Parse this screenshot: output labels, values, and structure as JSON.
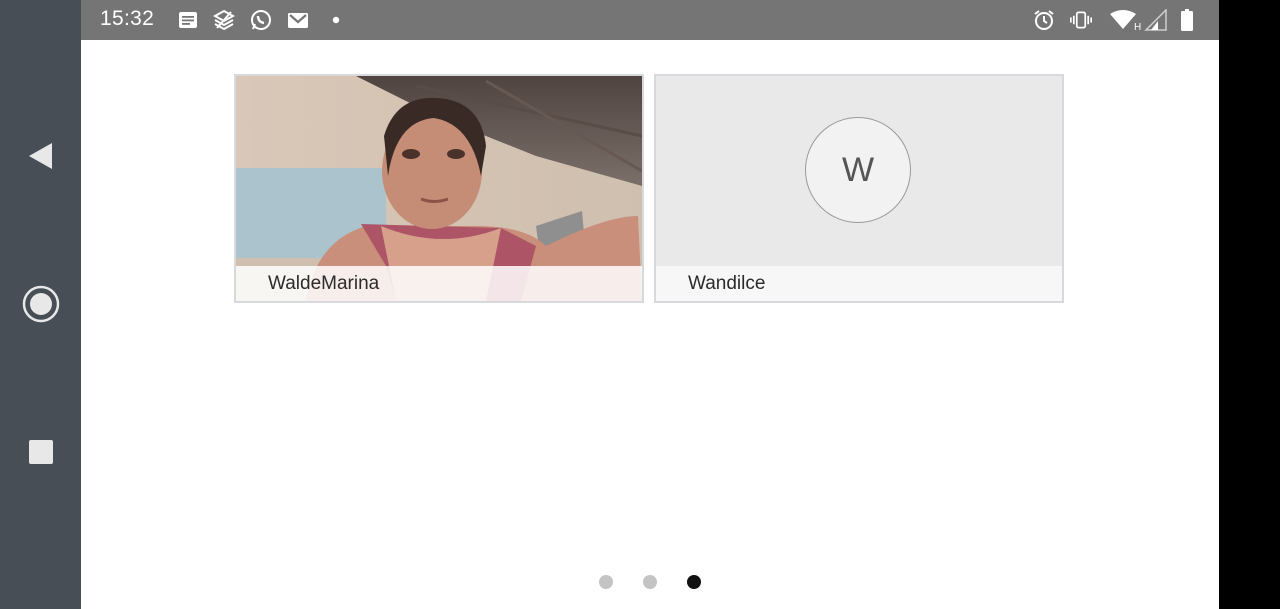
{
  "status_bar": {
    "time": "15:32",
    "left_icons": [
      "notes-icon",
      "stacks-icon",
      "whatsapp-icon",
      "gmail-icon",
      "dot-icon"
    ],
    "right_icons": [
      "alarm-icon",
      "vibrate-icon",
      "wifi-icon",
      "signal-icon",
      "battery-icon"
    ],
    "network_label": "H"
  },
  "navigation": {
    "buttons": [
      "back-icon",
      "home-icon",
      "recents-icon"
    ]
  },
  "participants": [
    {
      "name": "WaldeMarina",
      "has_video": true
    },
    {
      "name": "Wandilce",
      "has_video": false,
      "avatar_initial": "W"
    }
  ],
  "pagination": {
    "pages": 3,
    "active_page": 3
  },
  "colors": {
    "status_bar_bg": "#757575",
    "nav_bar_bg": "#474e55",
    "tile_border": "#d7d9dd",
    "active_dot": "#111111",
    "inactive_dot": "#c4c4c4"
  }
}
